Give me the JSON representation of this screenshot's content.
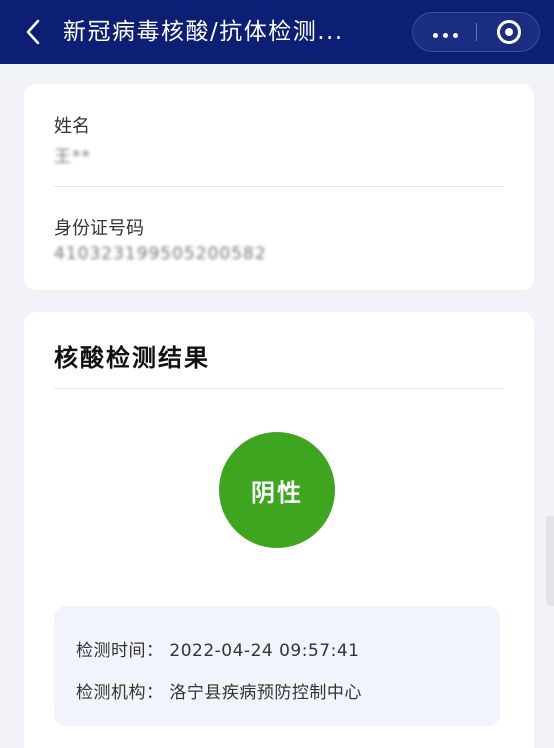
{
  "header": {
    "title": "新冠病毒核酸/抗体检测...",
    "back_icon": "chevron-left-icon",
    "more_icon": "more-dots-icon",
    "close_icon": "target-circle-icon",
    "background": "#0c1f75"
  },
  "person": {
    "name_label": "姓名",
    "name_value": "王**",
    "id_label": "身份证号码",
    "id_value": "410323199505200582"
  },
  "result": {
    "section_title": "核酸检测结果",
    "status": "阴性",
    "status_color": "#3ea51f",
    "time_label": "检测时间：",
    "time_value": "2022-04-24 09:57:41",
    "org_label": "检测机构：",
    "org_value": "洛宁县疾病预防控制中心"
  }
}
